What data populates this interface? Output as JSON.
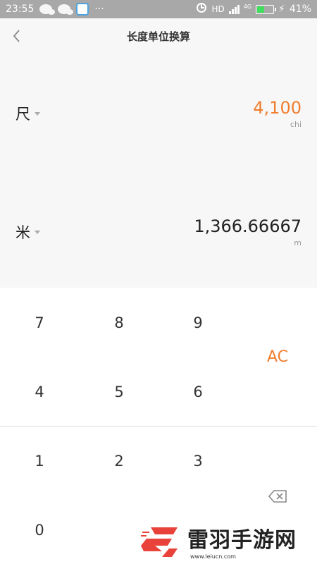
{
  "status_bar": {
    "time": "23:55",
    "dots": "···",
    "hd": "HD",
    "network": "4G",
    "battery_percent": "41%",
    "battery_level": 0.41
  },
  "header": {
    "title": "长度单位换算"
  },
  "converter": {
    "from": {
      "unit": "尺",
      "value": "4,100",
      "abbr": "chi"
    },
    "to": {
      "unit": "米",
      "value": "1,366.66667",
      "abbr": "m"
    }
  },
  "keypad": {
    "keys": [
      "7",
      "8",
      "9",
      "4",
      "5",
      "6",
      "1",
      "2",
      "3",
      "0"
    ],
    "clear_label": "AC"
  },
  "colors": {
    "accent": "#f07d2e",
    "background": "#f7f7f7",
    "status_bar": "#a8a8a8"
  },
  "watermark": {
    "name": "雷羽手游网",
    "url": "www.leiucn.com"
  }
}
